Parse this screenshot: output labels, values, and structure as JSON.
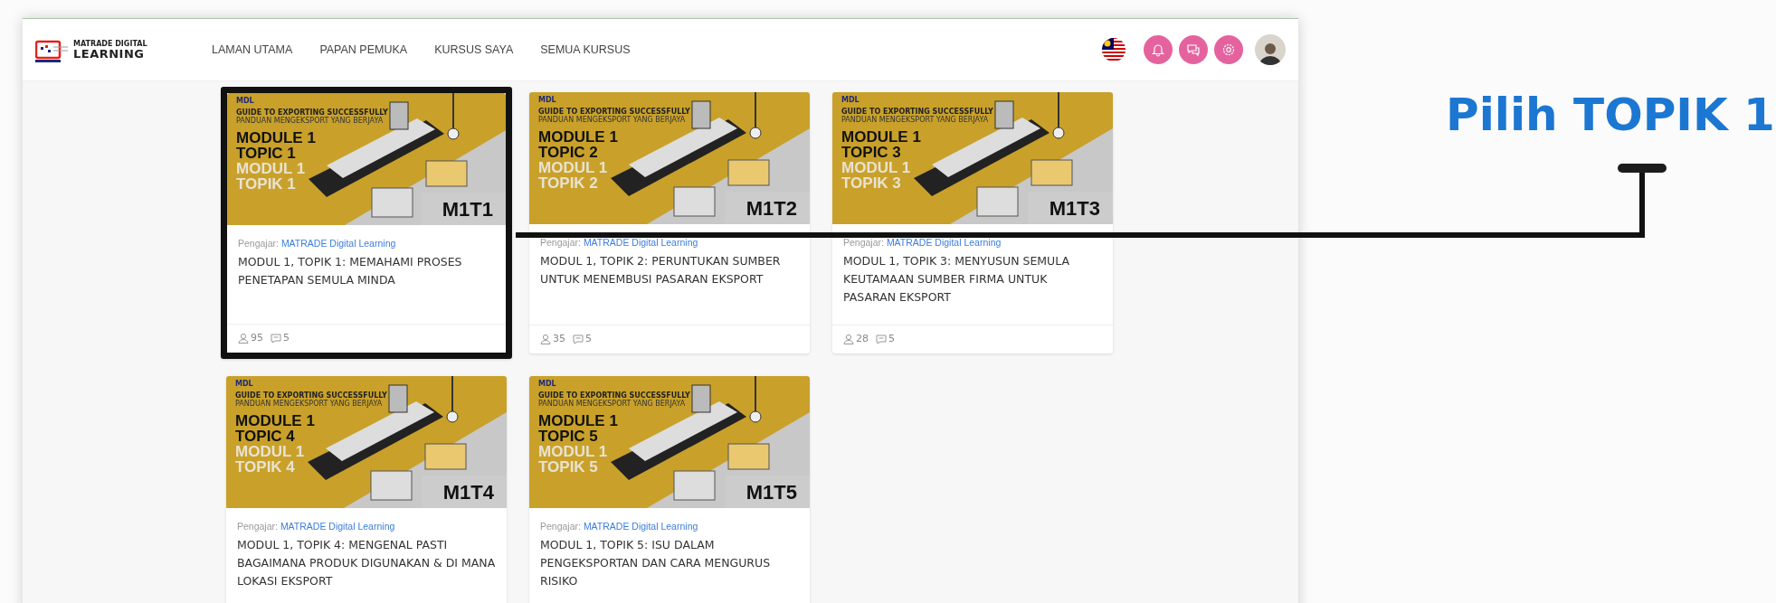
{
  "header": {
    "logo": {
      "top": "MATRADE DIGITAL",
      "bottom": "LEARNING"
    },
    "nav": [
      {
        "label": "LAMAN UTAMA"
      },
      {
        "label": "PAPAN PEMUKA"
      },
      {
        "label": "KURSUS SAYA"
      },
      {
        "label": "SEMUA KURSUS"
      }
    ]
  },
  "courses": [
    {
      "banner": {
        "mark": "MDL",
        "guide_en": "GUIDE TO EXPORTING SUCCESSFULLY",
        "guide_ms": "PANDUAN MENGEKSPORT YANG BERJAYA",
        "lines_en": [
          "MODULE 1",
          "TOPIC 1"
        ],
        "lines_ms": [
          "MODUL 1",
          "TOPIK 1"
        ],
        "code": "M1T1"
      },
      "instructor_label": "Pengajar:",
      "instructor": "MATRADE Digital Learning",
      "title": "MODUL 1, TOPIK 1: MEMAHAMI PROSES PENETAPAN SEMULA MINDA",
      "students": "95",
      "comments": "5",
      "highlighted": true
    },
    {
      "banner": {
        "mark": "MDL",
        "guide_en": "GUIDE TO EXPORTING SUCCESSFULLY",
        "guide_ms": "PANDUAN MENGEKSPORT YANG BERJAYA",
        "lines_en": [
          "MODULE 1",
          "TOPIC 2"
        ],
        "lines_ms": [
          "MODUL 1",
          "TOPIK 2"
        ],
        "code": "M1T2"
      },
      "instructor_label": "Pengajar:",
      "instructor": "MATRADE Digital Learning",
      "title": "MODUL 1, TOPIK 2: PERUNTUKAN SUMBER UNTUK MENEMBUSI PASARAN EKSPORT",
      "students": "35",
      "comments": "5",
      "highlighted": false
    },
    {
      "banner": {
        "mark": "MDL",
        "guide_en": "GUIDE TO EXPORTING SUCCESSFULLY",
        "guide_ms": "PANDUAN MENGEKSPORT YANG BERJAYA",
        "lines_en": [
          "MODULE 1",
          "TOPIC 3"
        ],
        "lines_ms": [
          "MODUL 1",
          "TOPIK 3"
        ],
        "code": "M1T3"
      },
      "instructor_label": "Pengajar:",
      "instructor": "MATRADE Digital Learning",
      "title": "MODUL 1, TOPIK 3: MENYUSUN SEMULA KEUTAMAAN SUMBER FIRMA UNTUK PASARAN EKSPORT",
      "students": "28",
      "comments": "5",
      "highlighted": false
    },
    {
      "banner": {
        "mark": "MDL",
        "guide_en": "GUIDE TO EXPORTING SUCCESSFULLY",
        "guide_ms": "PANDUAN MENGEKSPORT YANG BERJAYA",
        "lines_en": [
          "MODULE 1",
          "TOPIC 4"
        ],
        "lines_ms": [
          "MODUL 1",
          "TOPIK 4"
        ],
        "code": "M1T4"
      },
      "instructor_label": "Pengajar:",
      "instructor": "MATRADE Digital Learning",
      "title": "MODUL 1, TOPIK 4: MENGENAL PASTI BAGAIMANA PRODUK DIGUNAKAN & DI MANA LOKASI EKSPORT",
      "highlighted": false
    },
    {
      "banner": {
        "mark": "MDL",
        "guide_en": "GUIDE TO EXPORTING SUCCESSFULLY",
        "guide_ms": "PANDUAN MENGEKSPORT YANG BERJAYA",
        "lines_en": [
          "MODULE 1",
          "TOPIC 5"
        ],
        "lines_ms": [
          "MODUL 1",
          "TOPIK 5"
        ],
        "code": "M1T5"
      },
      "instructor_label": "Pengajar:",
      "instructor": "MATRADE Digital Learning",
      "title": "MODUL 1, TOPIK 5: ISU DALAM PENGEKSPORTAN DAN CARA MENGURUS RISIKO",
      "highlighted": false
    }
  ],
  "annotation": {
    "text": "Pilih TOPIK 1"
  }
}
